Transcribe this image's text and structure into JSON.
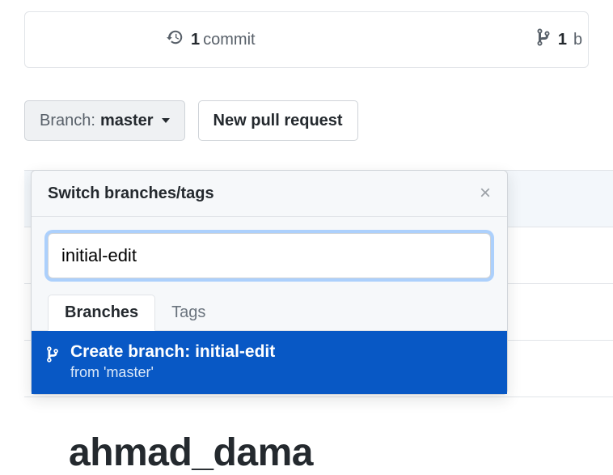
{
  "stats": {
    "commits_count": "1",
    "commits_label": "commit",
    "branches_count": "1",
    "branches_label": "b"
  },
  "toolbar": {
    "branch_prefix": "Branch:",
    "branch_name": "master",
    "new_pr_label": "New pull request"
  },
  "popover": {
    "title": "Switch branches/tags",
    "search_value": "initial-edit",
    "tabs": {
      "branches": "Branches",
      "tags": "Tags"
    },
    "result": {
      "create_prefix": "Create branch:",
      "branch_name": "initial-edit",
      "from_text": "from 'master'"
    }
  },
  "repo_name_partial": "ahmad_dama"
}
